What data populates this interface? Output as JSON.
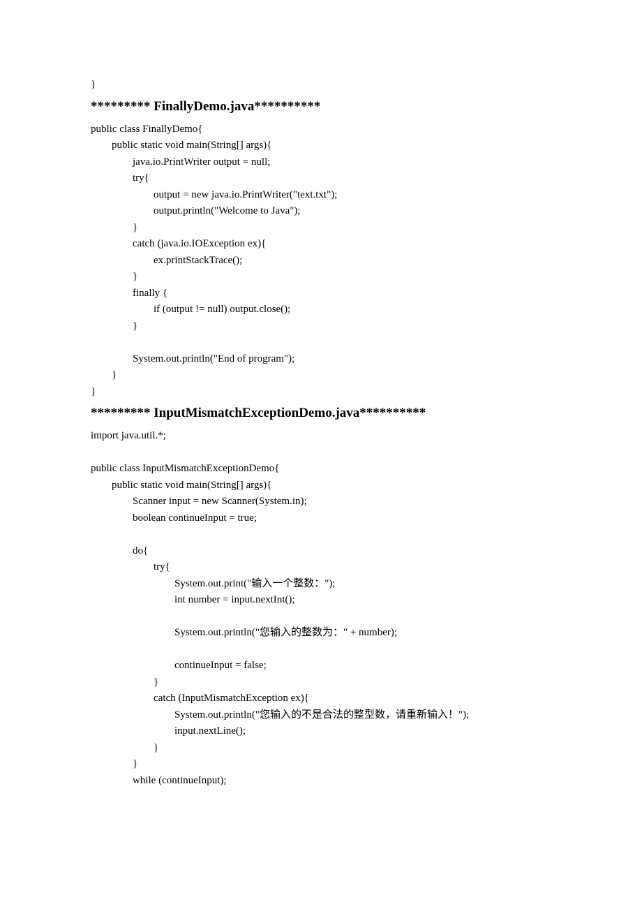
{
  "section1_end": "}",
  "heading1": "********* FinallyDemo.java**********",
  "code1": [
    "public class FinallyDemo{",
    "        public static void main(String[] args){",
    "                java.io.PrintWriter output = null;",
    "                try{",
    "                        output = new java.io.PrintWriter(\"text.txt\");",
    "                        output.println(\"Welcome to Java\");",
    "                }",
    "                catch (java.io.IOException ex){",
    "                        ex.printStackTrace();",
    "                }",
    "                finally {",
    "                        if (output != null) output.close();",
    "                }",
    "",
    "                System.out.println(\"End of program\");",
    "        }",
    "}"
  ],
  "heading2": "********* InputMismatchExceptionDemo.java**********",
  "code2": [
    "import java.util.*;",
    "",
    "public class InputMismatchExceptionDemo{",
    "        public static void main(String[] args){",
    "                Scanner input = new Scanner(System.in);",
    "                boolean continueInput = true;",
    "",
    "                do{",
    "                        try{",
    "                                System.out.print(\"输入一个整数：\");",
    "                                int number = input.nextInt();",
    "",
    "                                System.out.println(\"您输入的整数为：\" + number);",
    "",
    "                                continueInput = false;",
    "                        }",
    "                        catch (InputMismatchException ex){",
    "                                System.out.println(\"您输入的不是合法的整型数，请重新输入！\");",
    "                                input.nextLine();",
    "                        }",
    "                }",
    "                while (continueInput);"
  ]
}
